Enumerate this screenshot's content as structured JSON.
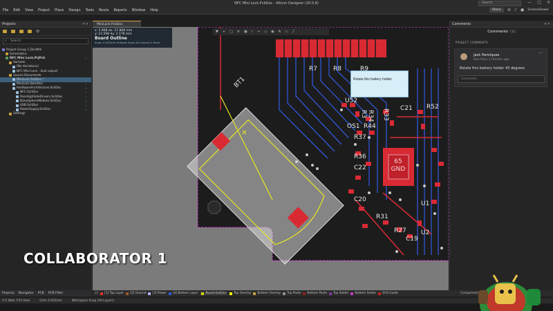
{
  "window": {
    "title": "NFC Mini Lock.PcbDoc - Altium Designer (20.0.6)",
    "search_placeholder": "Search",
    "controls": [
      "—",
      "□",
      "✕"
    ]
  },
  "menubar": {
    "items": [
      "File",
      "Edit",
      "View",
      "Project",
      "Place",
      "Design",
      "Tools",
      "Route",
      "Reports",
      "Window",
      "Help"
    ],
    "share_label": "Share",
    "user_name": "ScreenViewer"
  },
  "left_panel": {
    "title": "Projects",
    "search_placeholder": "Search",
    "tree": [
      {
        "label": "Project Group 1.DsnWrk",
        "indent": 0,
        "icon": "group",
        "ok": false
      },
      {
        "label": "Schematics",
        "indent": 1,
        "icon": "folder",
        "ok": false
      },
      {
        "label": "NFC Mini Lock.PrjPcb",
        "indent": 1,
        "icon": "proj",
        "ok": true,
        "bold": true
      },
      {
        "label": "Variants",
        "indent": 2,
        "icon": "folder",
        "ok": false
      },
      {
        "label": "[No Variations]",
        "indent": 3,
        "icon": "doc",
        "ok": false
      },
      {
        "label": "NFC Mini Lock - dual output",
        "indent": 3,
        "icon": "doc",
        "ok": false
      },
      {
        "label": "Source Documents",
        "indent": 2,
        "icon": "folder",
        "ok": false
      },
      {
        "label": "MiniLock.PcbDoc *",
        "indent": 3,
        "icon": "doc",
        "ok": true,
        "selected": true
      },
      {
        "label": "MiniLock.BomDoc",
        "indent": 3,
        "icon": "doc",
        "ok": true
      },
      {
        "label": "HardwareArchitecture.SchDoc",
        "indent": 3,
        "icon": "doc",
        "ok": true
      },
      {
        "label": "NFC.SchDoc",
        "indent": 4,
        "icon": "doc",
        "ok": true
      },
      {
        "label": "PassHighSideDrivers.SchDoc",
        "indent": 4,
        "icon": "doc",
        "ok": true
      },
      {
        "label": "NanoSphereModule.SchDoc",
        "indent": 4,
        "icon": "doc",
        "ok": true
      },
      {
        "label": "USB.SchDoc",
        "indent": 4,
        "icon": "doc",
        "ok": true
      },
      {
        "label": "PowerSupply.SchDoc",
        "indent": 4,
        "icon": "doc",
        "ok": true
      },
      {
        "label": "Settings",
        "indent": 2,
        "icon": "folder",
        "ok": false
      }
    ],
    "bottom_tabs": [
      "Projects",
      "Navigator",
      "PCB",
      "PCB Filter"
    ]
  },
  "document_tab": "MiniLock.PcbDoc",
  "hud": {
    "line1": "x:  5.968   dx: 17.868 mm",
    "line2": "y: 23.598   dy:  2.178 mm",
    "title": "Board Outline",
    "sub": "Snap: 0.025mm Hotspot Snap (All Layers) 0.5mm"
  },
  "canvas": {
    "comment_text": "Rotate this battery holder",
    "pcb_labels": [
      "BT1",
      "R7",
      "R8",
      "R9",
      "U52",
      "R3",
      "R34",
      "R33",
      "C21",
      "R52",
      "OS1",
      "R44",
      "R37",
      "R36",
      "C22",
      "C20",
      "R31",
      "R27",
      "C19",
      "U2",
      "U1",
      "GND",
      "65"
    ]
  },
  "overlay_label": "COLLABORATOR 1",
  "right_panel": {
    "header": "Comments",
    "title": "Comments",
    "count": "(1)",
    "section": "PROJECT COMMENTS",
    "comment": {
      "author": "Jack Henriques",
      "time": "less than 1 minute ago",
      "text": "Rotate this battery holder 45 degrees",
      "reply_placeholder": "Comment..."
    },
    "bottom_tabs": [
      "Components",
      "Comments",
      "Properties"
    ]
  },
  "layer_bar": {
    "page": "LS",
    "layers": [
      {
        "name": "[1] Top Layer",
        "color": "#e6322d"
      },
      {
        "name": "[2] Ground",
        "color": "#9a5a2a"
      },
      {
        "name": "[3] Power",
        "color": "#b0b0ff"
      },
      {
        "name": "[4] Bottom Layer",
        "color": "#2f58d8"
      },
      {
        "name": "Board Outline",
        "color": "#d4d400",
        "active": true
      },
      {
        "name": "Top Overlay",
        "color": "#ffff00"
      },
      {
        "name": "Bottom Overlay",
        "color": "#c0a040"
      },
      {
        "name": "Top Paste",
        "color": "#909090"
      },
      {
        "name": "Bottom Paste",
        "color": "#8a2020"
      },
      {
        "name": "Top Solder",
        "color": "#7a3a9a"
      },
      {
        "name": "Bottom Solder",
        "color": "#c040c0"
      },
      {
        "name": "Drill Guide",
        "color": "#cc2222"
      }
    ]
  },
  "status": [
    "X:5 Walk Y:53 Hole",
    "Grid: 0.025mm",
    "Workspace Snap (All Layers)"
  ]
}
